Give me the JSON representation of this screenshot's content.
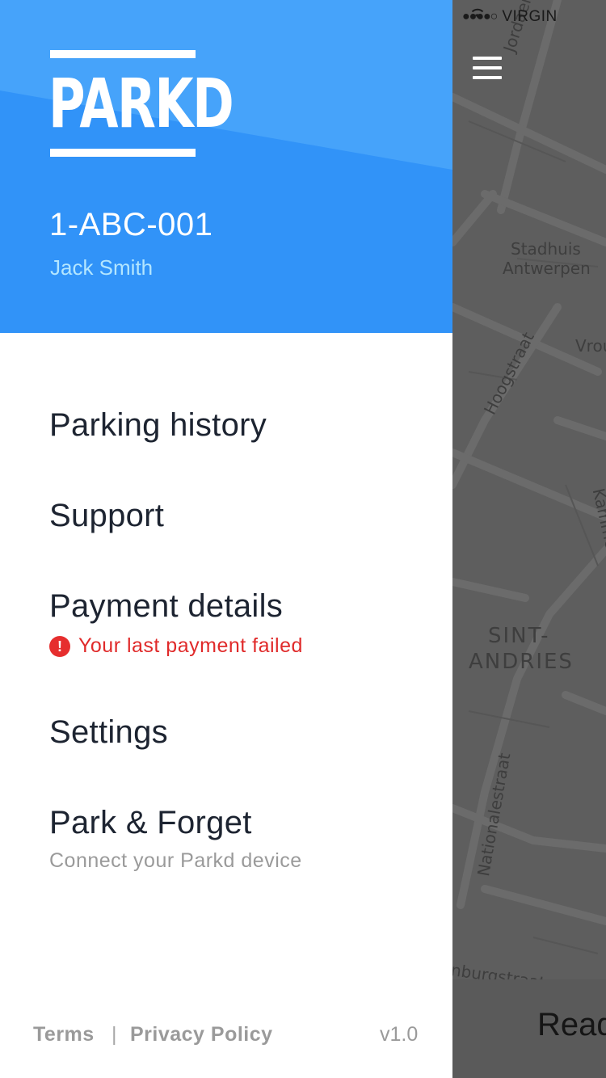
{
  "status_bar": {
    "signal": "●●●●○",
    "carrier": "VIRGIN"
  },
  "map": {
    "labels": {
      "jordaen": "Jordaen",
      "stadhuis": "Stadhuis",
      "antwerpen": "Antwerpen",
      "vrou": "Vrou",
      "hoogstraat": "Hoogstraat",
      "kammen": "Kamme",
      "sint": "SINT-",
      "andries": "ANDRIES",
      "nationalestraat": "Nationalestraat",
      "burgstraat": "nburgstraat"
    },
    "bottom_bar": {
      "ready_label": "Read"
    }
  },
  "drawer": {
    "logo": "PARKD",
    "plate": "1-ABC-001",
    "user_name": "Jack Smith",
    "menu": {
      "parking_history": "Parking history",
      "support": "Support",
      "payment_details": "Payment details",
      "payment_alert_icon": "!",
      "payment_alert": "Your last payment failed",
      "settings": "Settings",
      "park_forget": "Park & Forget",
      "park_forget_sub": "Connect your Parkd device"
    },
    "footer": {
      "terms": "Terms",
      "separator": "|",
      "privacy": "Privacy Policy",
      "version": "v1.0"
    }
  },
  "colors": {
    "header_blue": "#3193f8",
    "alert_red": "#e02a2a",
    "map_gray": "#5e5e5e"
  }
}
